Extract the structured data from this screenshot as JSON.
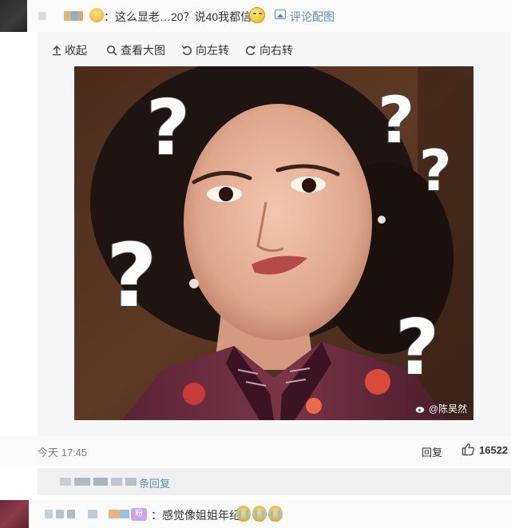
{
  "comment": {
    "text_before_hand": "：",
    "text": "这么显老…20？说40我都信",
    "view_pic_link": "评论配图",
    "hand_emoji": "hand-emoji-icon",
    "face_emoji": "grin-face-emoji-icon"
  },
  "toolbar": {
    "collapse": "收起",
    "view_large": "查看大图",
    "rotate_left": "向左转",
    "rotate_right": "向右转"
  },
  "image": {
    "watermark": "@陈昊然",
    "subject": "woman-with-question-marks"
  },
  "meta": {
    "time": "今天 17:45",
    "reply_label": "回复",
    "like_count": "16522"
  },
  "replies": {
    "suffix": "条回复"
  },
  "comment2": {
    "badge": "粉",
    "text": "：感觉像姐姐年纪"
  },
  "colors": {
    "link": "#5b8bb8",
    "page_bg": "#fafafa",
    "card_bg": "#f7f7f7"
  }
}
